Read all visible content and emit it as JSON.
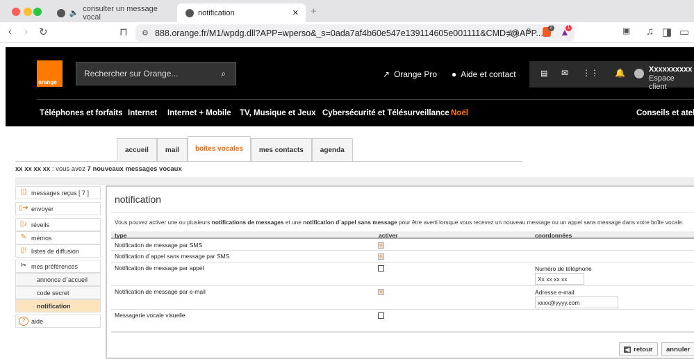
{
  "browser": {
    "tabs": [
      {
        "title": "consulter un message vocal"
      },
      {
        "title": "notification"
      }
    ],
    "url": "888.orange.fr/M1/wpdg.dll?APP=wperso&_s=0ada7af4b60e547e139114605e001111&CMD=@APP...",
    "badges": {
      "brave": "2",
      "rewards": "1"
    }
  },
  "header": {
    "logo": "orange",
    "search_placeholder": "Rechercher sur Orange...",
    "orange_pro": "Orange Pro",
    "aide": "Aide et contact",
    "user_name": "Xxxxxxxxxx",
    "user_sub": "Espace client",
    "nav": [
      "Téléphones et forfaits",
      "Internet",
      "Internet + Mobile",
      "TV, Musique et Jeux",
      "Cybersécurité et Télésurveillance",
      "Noël",
      "Conseils et ateliers"
    ]
  },
  "tabs": [
    "accueil",
    "mail",
    "boîtes vocales",
    "mes contacts",
    "agenda"
  ],
  "status": {
    "number": "xx xx xx xx",
    "mid": " : vous avez ",
    "count": "7 nouveaux messages vocaux"
  },
  "sidebar": [
    {
      "label": "messages reçus [ 7 ]",
      "icon": "speaker-icon"
    },
    {
      "label": "envoyer",
      "icon": "arrow-icon"
    },
    {
      "label": "réveils",
      "icon": "bell-icon"
    },
    {
      "label": "mémos",
      "icon": "memo-icon"
    },
    {
      "label": "listes de diffusion",
      "icon": "list-icon"
    },
    {
      "label": "mes préférences",
      "icon": "tools-icon"
    },
    {
      "label": "annonce d´accueil"
    },
    {
      "label": "code secret"
    },
    {
      "label": "notification"
    },
    {
      "label": "aide",
      "icon": "help-icon"
    }
  ],
  "main": {
    "title": "notification",
    "desc": {
      "a": "Vous pouvez activer une ou plusieurs ",
      "b": "notifications de messages",
      "c": " et une ",
      "d": "notification d´appel sans message",
      "e": " pour être averti lorsque vous recevez un nouveau message ou un appel sans message dans votre boîte vocale."
    },
    "columns": [
      "type",
      "activer",
      "coordonnées"
    ],
    "rows": [
      {
        "type": "Notification de message par SMS",
        "checked": true
      },
      {
        "type": "Notification d´appel sans message par SMS",
        "checked": true
      },
      {
        "type": "Notification de message par appel",
        "checked": false,
        "label": "Numéro de téléphone",
        "value": "Xx xx xx xx"
      },
      {
        "type": "Notification de message par e-mail",
        "checked": true,
        "label": "Adresse e-mail",
        "value": "xxxx@yyyy.com"
      },
      {
        "type": "Messagerie vocale visuelle",
        "checked": false
      }
    ],
    "retour": "retour",
    "annuler": "annuler"
  }
}
